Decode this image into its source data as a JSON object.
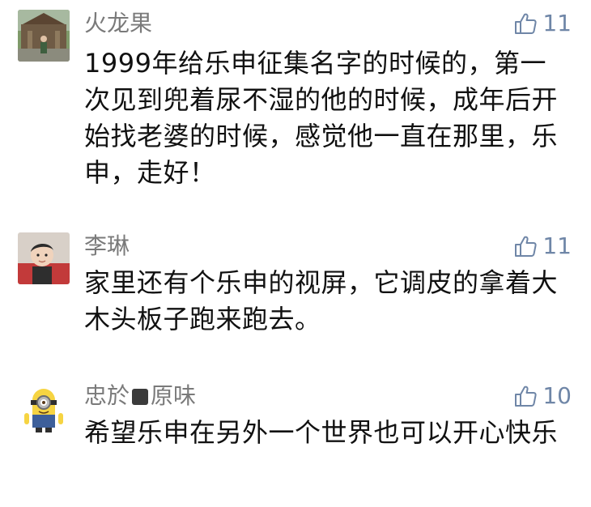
{
  "comments": [
    {
      "username": "火龙果",
      "likes": "11",
      "text": "1999年给乐申征集名字的时候的，第一次见到兜着尿不湿的他的时候，成年后开始找老婆的时候，感觉他一直在那里，乐申，走好！"
    },
    {
      "username": "李琳",
      "likes": "11",
      "text": "家里还有个乐申的视屏，它调皮的拿着大木头板子跑来跑去。"
    },
    {
      "username_prefix": "忠於",
      "username_suffix": "原味",
      "likes": "10",
      "text": "希望乐申在另外一个世界也可以开心快乐"
    }
  ],
  "colors": {
    "username": "#7a7a7a",
    "like_count": "#6f86a7",
    "text": "#111111"
  },
  "icons": {
    "like": "thumbs-up-outline-icon"
  }
}
